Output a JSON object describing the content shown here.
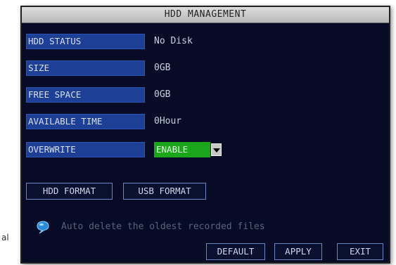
{
  "stray_text": "al",
  "dialog": {
    "title": "HDD MANAGEMENT",
    "fields": [
      {
        "label": "HDD STATUS",
        "value": "No Disk"
      },
      {
        "label": "SIZE",
        "value": "0GB"
      },
      {
        "label": "FREE SPACE",
        "value": "0GB"
      },
      {
        "label": "AVAILABLE TIME",
        "value": "0Hour"
      }
    ],
    "overwrite": {
      "label": "OVERWRITE",
      "selected": "ENABLE"
    },
    "format_buttons": {
      "hdd": "HDD FORMAT",
      "usb": "USB FORMAT"
    },
    "hint": {
      "icon": "speech-bubble-icon",
      "text": "Auto delete the oldest recorded files"
    },
    "footer_buttons": {
      "default": "DEFAULT",
      "apply": "APPLY",
      "exit": "EXIT"
    },
    "colors": {
      "panel": "#070b26",
      "label_bg": "#1d3f96",
      "select_bg": "#1aa51a",
      "title_bg": "#c8c8c8"
    }
  }
}
